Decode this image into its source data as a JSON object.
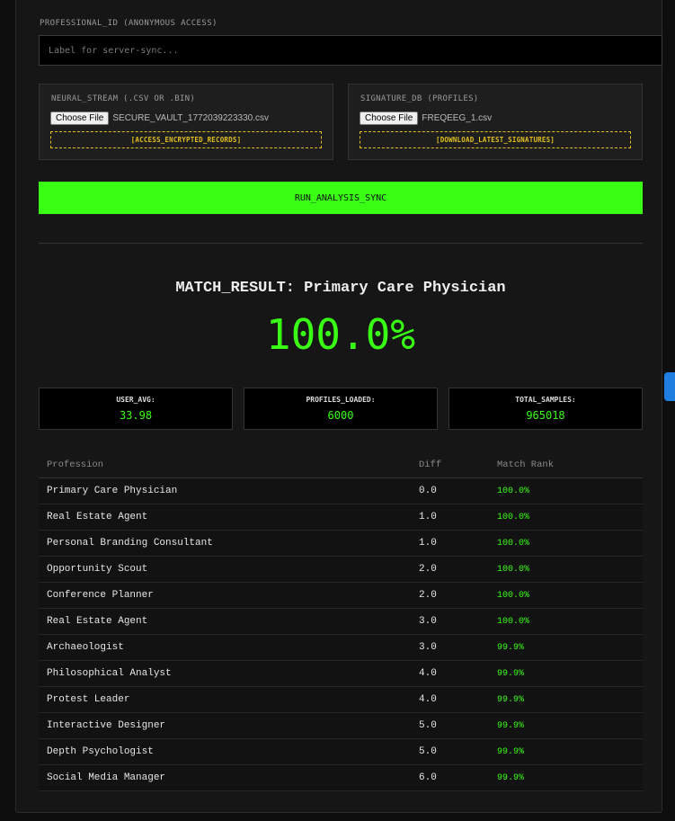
{
  "professional_id": {
    "label": "PROFESSIONAL_ID (ANONYMOUS ACCESS)",
    "placeholder": "Label for server-sync..."
  },
  "neural_stream": {
    "title": "NEURAL_STREAM (.CSV OR .BIN)",
    "choose_label": "Choose File",
    "file_name": "SECURE_VAULT_1772039223330.csv",
    "link": "[ACCESS_ENCRYPTED_RECORDS]"
  },
  "signature_db": {
    "title": "SIGNATURE_DB (PROFILES)",
    "choose_label": "Choose File",
    "file_name": "FREQEEG_1.csv",
    "link": "[DOWNLOAD_LATEST_SIGNATURES]"
  },
  "run_button": "RUN_ANALYSIS_SYNC",
  "match": {
    "result": "MATCH_RESULT: Primary Care Physician",
    "percent": "100.0%"
  },
  "stats": [
    {
      "label": "USER_AVG:",
      "value": "33.98"
    },
    {
      "label": "PROFILES_LOADED:",
      "value": "6000"
    },
    {
      "label": "TOTAL_SAMPLES:",
      "value": "965018"
    }
  ],
  "table": {
    "headers": [
      "Profession",
      "Diff",
      "Match Rank"
    ],
    "rows": [
      [
        "Primary Care Physician",
        "0.0",
        "100.0%"
      ],
      [
        "Real Estate Agent",
        "1.0",
        "100.0%"
      ],
      [
        "Personal Branding Consultant",
        "1.0",
        "100.0%"
      ],
      [
        "Opportunity Scout",
        "2.0",
        "100.0%"
      ],
      [
        "Conference Planner",
        "2.0",
        "100.0%"
      ],
      [
        "Real Estate Agent",
        "3.0",
        "100.0%"
      ],
      [
        "Archaeologist",
        "3.0",
        "99.9%"
      ],
      [
        "Philosophical Analyst",
        "4.0",
        "99.9%"
      ],
      [
        "Protest Leader",
        "4.0",
        "99.9%"
      ],
      [
        "Interactive Designer",
        "5.0",
        "99.9%"
      ],
      [
        "Depth Psychologist",
        "5.0",
        "99.9%"
      ],
      [
        "Social Media Manager",
        "6.0",
        "99.9%"
      ]
    ]
  },
  "colors": {
    "accent": "#39ff14",
    "warning": "#e0c020",
    "background": "#161616"
  }
}
